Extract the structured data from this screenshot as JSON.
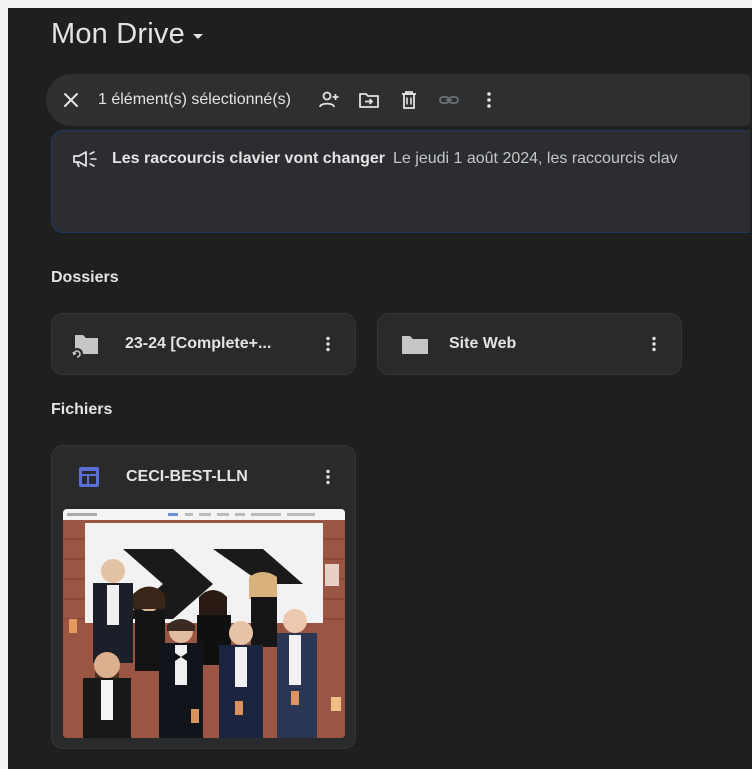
{
  "header": {
    "title": "Mon Drive"
  },
  "selection_bar": {
    "count_label": "1 élément(s) sélectionné(s)"
  },
  "banner": {
    "title": "Les raccourcis clavier vont changer",
    "body": "Le jeudi 1 août 2024, les raccourcis clav"
  },
  "sections": {
    "folders_label": "Dossiers",
    "files_label": "Fichiers"
  },
  "folders": [
    {
      "name": "23-24 [Complete+..."
    },
    {
      "name": "Site Web"
    }
  ],
  "files": [
    {
      "name": "CECI-BEST-LLN",
      "type_icon": "google-sites-icon"
    }
  ],
  "colors": {
    "background": "#1f1f1f",
    "card": "#282a2c",
    "text": "#e3e3e3",
    "sites_icon": "#5b6fd6",
    "banner_border": "#1c3a5e"
  }
}
